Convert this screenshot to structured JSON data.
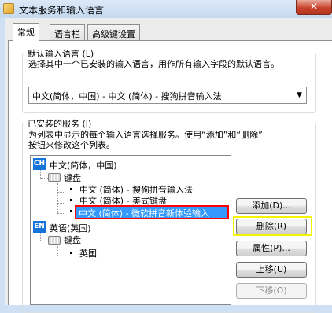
{
  "window": {
    "title": "文本服务和输入语言",
    "close_glyph": "✕",
    "icon": "keyboard-flag-icon"
  },
  "tabs": [
    {
      "label": "常规",
      "active": true
    },
    {
      "label": "语言栏",
      "active": false
    },
    {
      "label": "高级键设置",
      "active": false
    }
  ],
  "default_language": {
    "legend": "默认输入语言 (L)",
    "description": "选择其中一个已安装的输入语言，用作所有输入字段的默认语言。",
    "selected": "中文(简体，中国) - 中文 (简体) - 搜狗拼音输入法",
    "arrow": "▼"
  },
  "installed_services": {
    "legend": "已安装的服务 (I)",
    "description_line1": "为列表中显示的每个输入语言选择服务。使用“添加”和“删除”",
    "description_line2": "按钮来修改这个列表。",
    "tree": {
      "lang1": {
        "code": "CH",
        "label": "中文(简体，中国)"
      },
      "keyboard1": "键盘",
      "services": [
        "中文 (简体) - 搜狗拼音输入法",
        "中文 (简体) - 美式键盘",
        "中文 (简体) - 微软拼音新体验输入"
      ],
      "lang2": {
        "code": "EN",
        "label": "英语(英国)"
      },
      "keyboard2": "键盘",
      "service2": "英国"
    }
  },
  "buttons": {
    "add": "添加(D)...",
    "remove": "删除(R)",
    "properties": "属性(P)...",
    "move_up": "上移(U)",
    "move_down": "下移(O)"
  },
  "colors": {
    "selection": "#3399ff",
    "annotation_red": "#ff0000",
    "annotation_yellow": "#f4f400",
    "language_icon": "#1574d9"
  }
}
